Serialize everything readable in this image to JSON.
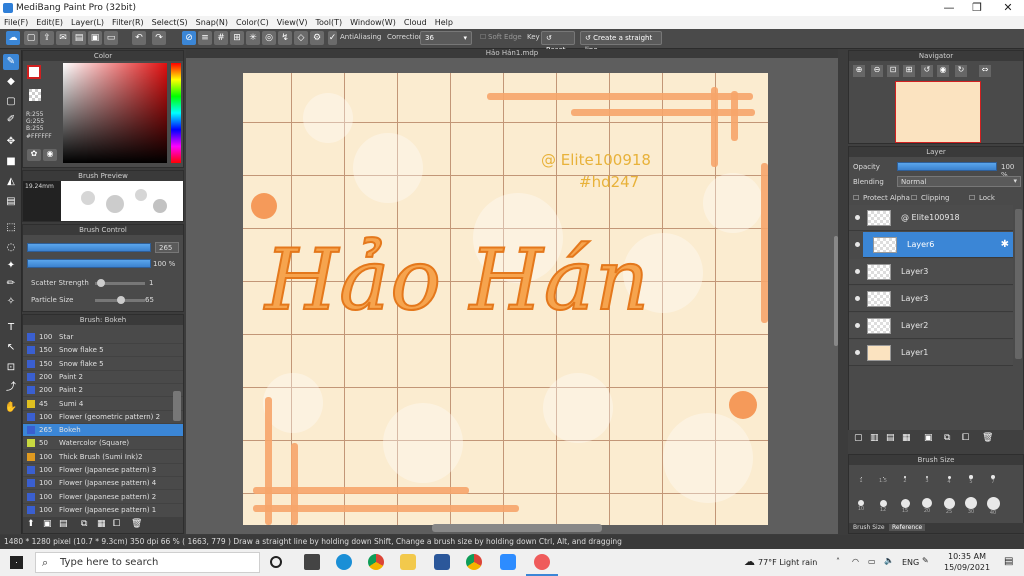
{
  "window": {
    "title": "MediBang Paint Pro (32bit)"
  },
  "menu": [
    "File(F)",
    "Edit(E)",
    "Layer(L)",
    "Filter(R)",
    "Select(S)",
    "Snap(N)",
    "Color(C)",
    "View(V)",
    "Tool(T)",
    "Window(W)",
    "Cloud",
    "Help"
  ],
  "toolbar": {
    "antialias_label": "AntiAliasing",
    "correction_label": "Correction",
    "correction_value": "36",
    "soft_edge_label": "Soft Edge",
    "key_label": "Key",
    "reset_label": "Reset",
    "straight_line_label": "Create a straight line"
  },
  "color_panel": {
    "title": "Color",
    "r": "R:255",
    "g": "G:255",
    "b": "B:255",
    "hex": "#FFFFFF"
  },
  "brush_preview": {
    "title": "Brush Preview",
    "size": "19.24mm"
  },
  "brush_control": {
    "title": "Brush Control",
    "size_value": "265",
    "opacity_value": "100 %",
    "scatter_label": "Scatter Strength",
    "scatter_value": "1",
    "particle_label": "Particle Size",
    "particle_value": "65"
  },
  "brush_list": {
    "title": "Brush: Bokeh",
    "items": [
      {
        "size": "100",
        "name": "Star",
        "color": "#3a5fd0"
      },
      {
        "size": "150",
        "name": "Snow flake 5",
        "color": "#3a5fd0"
      },
      {
        "size": "150",
        "name": "Snow flake 5",
        "color": "#3a5fd0"
      },
      {
        "size": "200",
        "name": "Paint 2",
        "color": "#3a5fd0"
      },
      {
        "size": "200",
        "name": "Paint 2",
        "color": "#3a5fd0"
      },
      {
        "size": "45",
        "name": "Sumi 4",
        "color": "#e0c020"
      },
      {
        "size": "100",
        "name": "Flower (geometric pattern) 2",
        "color": "#3a5fd0"
      },
      {
        "size": "265",
        "name": "Bokeh",
        "color": "#3a5fd0"
      },
      {
        "size": "50",
        "name": "Watercolor (Square)",
        "color": "#c8d840"
      },
      {
        "size": "100",
        "name": "Thick Brush (Sumi Ink)2",
        "color": "#e09a20"
      },
      {
        "size": "100",
        "name": "Flower (Japanese pattern) 3",
        "color": "#3a5fd0"
      },
      {
        "size": "100",
        "name": "Flower (Japanese pattern) 4",
        "color": "#3a5fd0"
      },
      {
        "size": "100",
        "name": "Flower (Japanese pattern) 2",
        "color": "#3a5fd0"
      },
      {
        "size": "100",
        "name": "Flower (Japanese pattern) 1",
        "color": "#3a5fd0"
      }
    ]
  },
  "document": {
    "tab": "Hảo Hán1.mdp"
  },
  "artwork": {
    "watermark1": "@ Elite100918",
    "watermark2": "#hd247",
    "title_text": "Hảo Hán"
  },
  "navigator": {
    "title": "Navigator"
  },
  "layer_panel": {
    "title": "Layer",
    "opacity_label": "Opacity",
    "opacity_value": "100 %",
    "blending_label": "Blending",
    "blending_value": "Normal",
    "protect_alpha": "Protect Alpha",
    "clipping": "Clipping",
    "lock": "Lock",
    "layers": [
      {
        "name": "@ Elite100918"
      },
      {
        "name": "Layer6"
      },
      {
        "name": "Layer3"
      },
      {
        "name": "Layer3"
      },
      {
        "name": "Layer2"
      },
      {
        "name": "Layer1"
      }
    ]
  },
  "brush_size": {
    "title": "Brush Size",
    "values": [
      "1",
      "1.5",
      "2",
      "3",
      "4",
      "5",
      "7",
      "10",
      "12",
      "15",
      "20",
      "25",
      "30",
      "40"
    ],
    "tab1": "Brush Size",
    "tab2": "Reference"
  },
  "status": {
    "text": "1480 * 1280 pixel  (10.7 * 9.3cm)  350 dpi  66 %  ( 1663, 779 )  Draw a straight line by holding down Shift, Change a brush size by holding down Ctrl, Alt, and dragging"
  },
  "taskbar": {
    "search_placeholder": "Type here to search",
    "weather": "77°F  Light rain",
    "lang": "ENG",
    "time": "10:35 AM",
    "date": "15/09/2021"
  }
}
